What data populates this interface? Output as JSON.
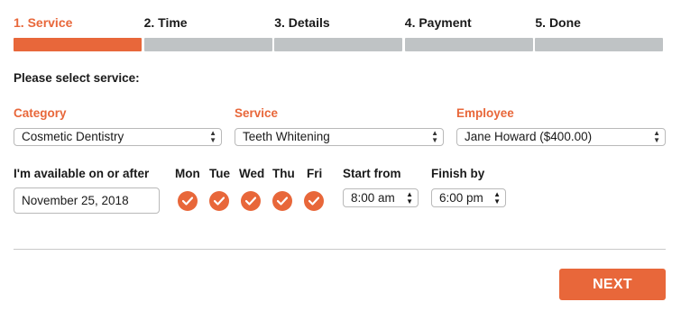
{
  "steps": [
    {
      "label": "1. Service",
      "active": true
    },
    {
      "label": "2. Time",
      "active": false
    },
    {
      "label": "3. Details",
      "active": false
    },
    {
      "label": "4. Payment",
      "active": false
    },
    {
      "label": "5. Done",
      "active": false
    }
  ],
  "prompt": "Please select service:",
  "category": {
    "label": "Category",
    "value": "Cosmetic Dentistry"
  },
  "service": {
    "label": "Service",
    "value": "Teeth Whitening"
  },
  "employee": {
    "label": "Employee",
    "value": "Jane Howard ($400.00)"
  },
  "availability": {
    "label": "I'm available on or after",
    "date": "November 25, 2018"
  },
  "days": [
    {
      "name": "Mon",
      "checked": true
    },
    {
      "name": "Tue",
      "checked": true
    },
    {
      "name": "Wed",
      "checked": true
    },
    {
      "name": "Thu",
      "checked": true
    },
    {
      "name": "Fri",
      "checked": true
    }
  ],
  "start": {
    "label": "Start from",
    "value": "8:00 am"
  },
  "finish": {
    "label": "Finish by",
    "value": "6:00 pm"
  },
  "next_label": "NEXT",
  "colors": {
    "accent": "#e8673a",
    "inactive_bar": "#bfc3c5"
  },
  "icons": {
    "check": "check-icon",
    "select_arrows": "up-down-chevron-icon"
  }
}
